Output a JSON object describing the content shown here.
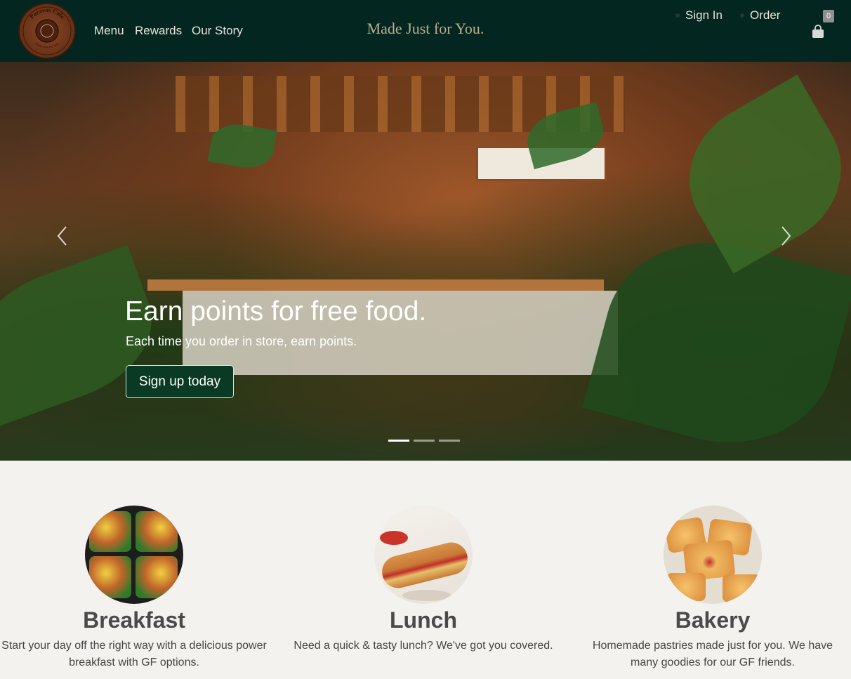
{
  "nav": {
    "logo_text": "Paravos Cafe",
    "logo_subtext": "Made Just for You",
    "links": [
      "Menu",
      "Rewards",
      "Our Story"
    ],
    "tagline": "Made Just for You.",
    "sign_in": "Sign In",
    "order": "Order",
    "cart_count": "0",
    "icons": {
      "cart": "shopping-bag-icon"
    }
  },
  "hero": {
    "title": "Earn points for free food.",
    "subtitle": "Each time you order in store, earn points.",
    "button": "Sign up today",
    "active_slide": 1,
    "slide_count": 3,
    "icons": {
      "prev": "chevron-left-icon",
      "next": "chevron-right-icon"
    }
  },
  "features": [
    {
      "title": "Breakfast",
      "text": "Start your day off the right way with a delicious power breakfast with GF options."
    },
    {
      "title": "Lunch",
      "text": "Need a quick & tasty lunch? We've got you covered."
    },
    {
      "title": "Bakery",
      "text": "Homemade pastries made just for you. We have many goodies for our GF friends."
    }
  ],
  "colors": {
    "navbar": "#042620",
    "tagline": "#b9ad8f",
    "button": "#0a3a24",
    "page_bg": "#f3f2ef",
    "heading": "#4a4a4a"
  }
}
